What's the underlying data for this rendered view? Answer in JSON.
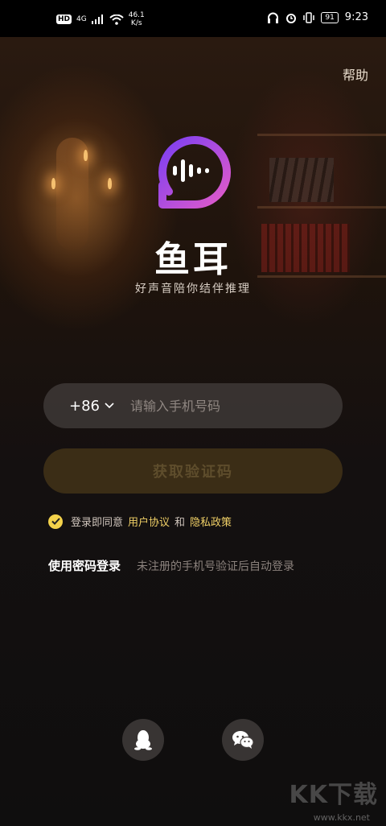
{
  "status_bar": {
    "hd": "HD",
    "network": "4G",
    "speed_value": "46.1",
    "speed_unit": "K/s",
    "battery": "91",
    "time": "9:23"
  },
  "header": {
    "help": "帮助"
  },
  "brand": {
    "app_name": "鱼耳",
    "slogan": "好声音陪你结伴推理",
    "logo_gradient": [
      "#7b3ff2",
      "#e35bc9"
    ]
  },
  "form": {
    "country_code": "+86",
    "phone_placeholder": "请输入手机号码",
    "get_code_label": "获取验证码"
  },
  "agreement": {
    "prefix": "登录即同意",
    "user_agreement": "用户协议",
    "and": "和",
    "privacy_policy": "隐私政策"
  },
  "password_login": {
    "label": "使用密码登录",
    "hint": "未注册的手机号验证后自动登录"
  },
  "social": {
    "qq_icon": "qq-icon",
    "wechat_icon": "wechat-icon"
  },
  "watermark": {
    "text": "KK下载",
    "url": "www.kkx.net"
  },
  "colors": {
    "accent_yellow": "#f3d24b",
    "link_yellow": "#f0d067",
    "button_bg": "#3b2d16"
  }
}
